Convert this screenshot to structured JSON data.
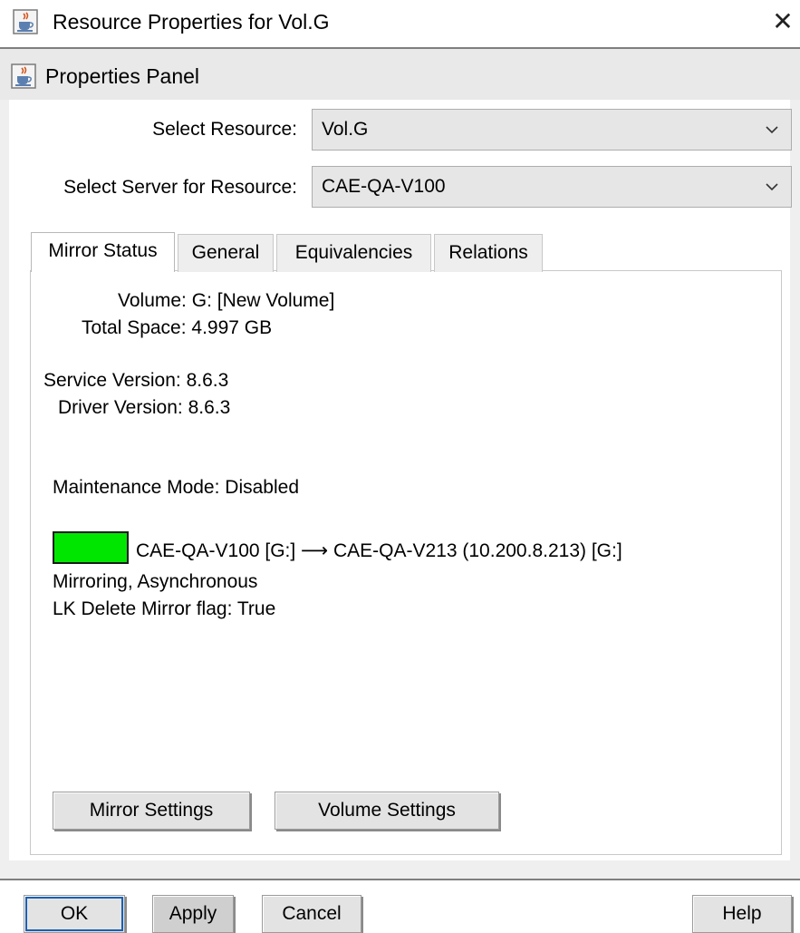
{
  "window": {
    "title": "Resource Properties for Vol.G",
    "app_icon": "java-cup-icon",
    "close_glyph": "✕"
  },
  "panel": {
    "title": "Properties Panel",
    "icon": "java-cup-icon"
  },
  "selectors": {
    "resource_label": "Select Resource:",
    "resource_value": "Vol.G",
    "server_label": "Select Server for Resource:",
    "server_value": "CAE-QA-V100"
  },
  "tabs": [
    {
      "label": "Mirror Status",
      "selected": true
    },
    {
      "label": "General",
      "selected": false
    },
    {
      "label": "Equivalencies",
      "selected": false
    },
    {
      "label": "Relations",
      "selected": false
    }
  ],
  "mirror_status": {
    "volume_label": "Volume:",
    "volume_value": "G: [New Volume]",
    "total_space_label": "Total Space:",
    "total_space_value": "4.997 GB",
    "service_version_label": "Service Version:",
    "service_version_value": "8.6.3",
    "driver_version_label": "Driver Version:",
    "driver_version_value": "8.6.3",
    "maintenance_mode_label": "Maintenance Mode:",
    "maintenance_mode_value": "Disabled",
    "status_color": "#00e600",
    "mirror_path": "CAE-QA-V100 [G:] ⟶ CAE-QA-V213 (10.200.8.213) [G:]",
    "mirror_type": "Mirroring, Asynchronous",
    "lk_delete_flag": "LK Delete Mirror flag: True",
    "mirror_settings_label": "Mirror Settings",
    "volume_settings_label": "Volume Settings"
  },
  "dialog_buttons": {
    "ok": "OK",
    "apply": "Apply",
    "cancel": "Cancel",
    "help": "Help"
  }
}
